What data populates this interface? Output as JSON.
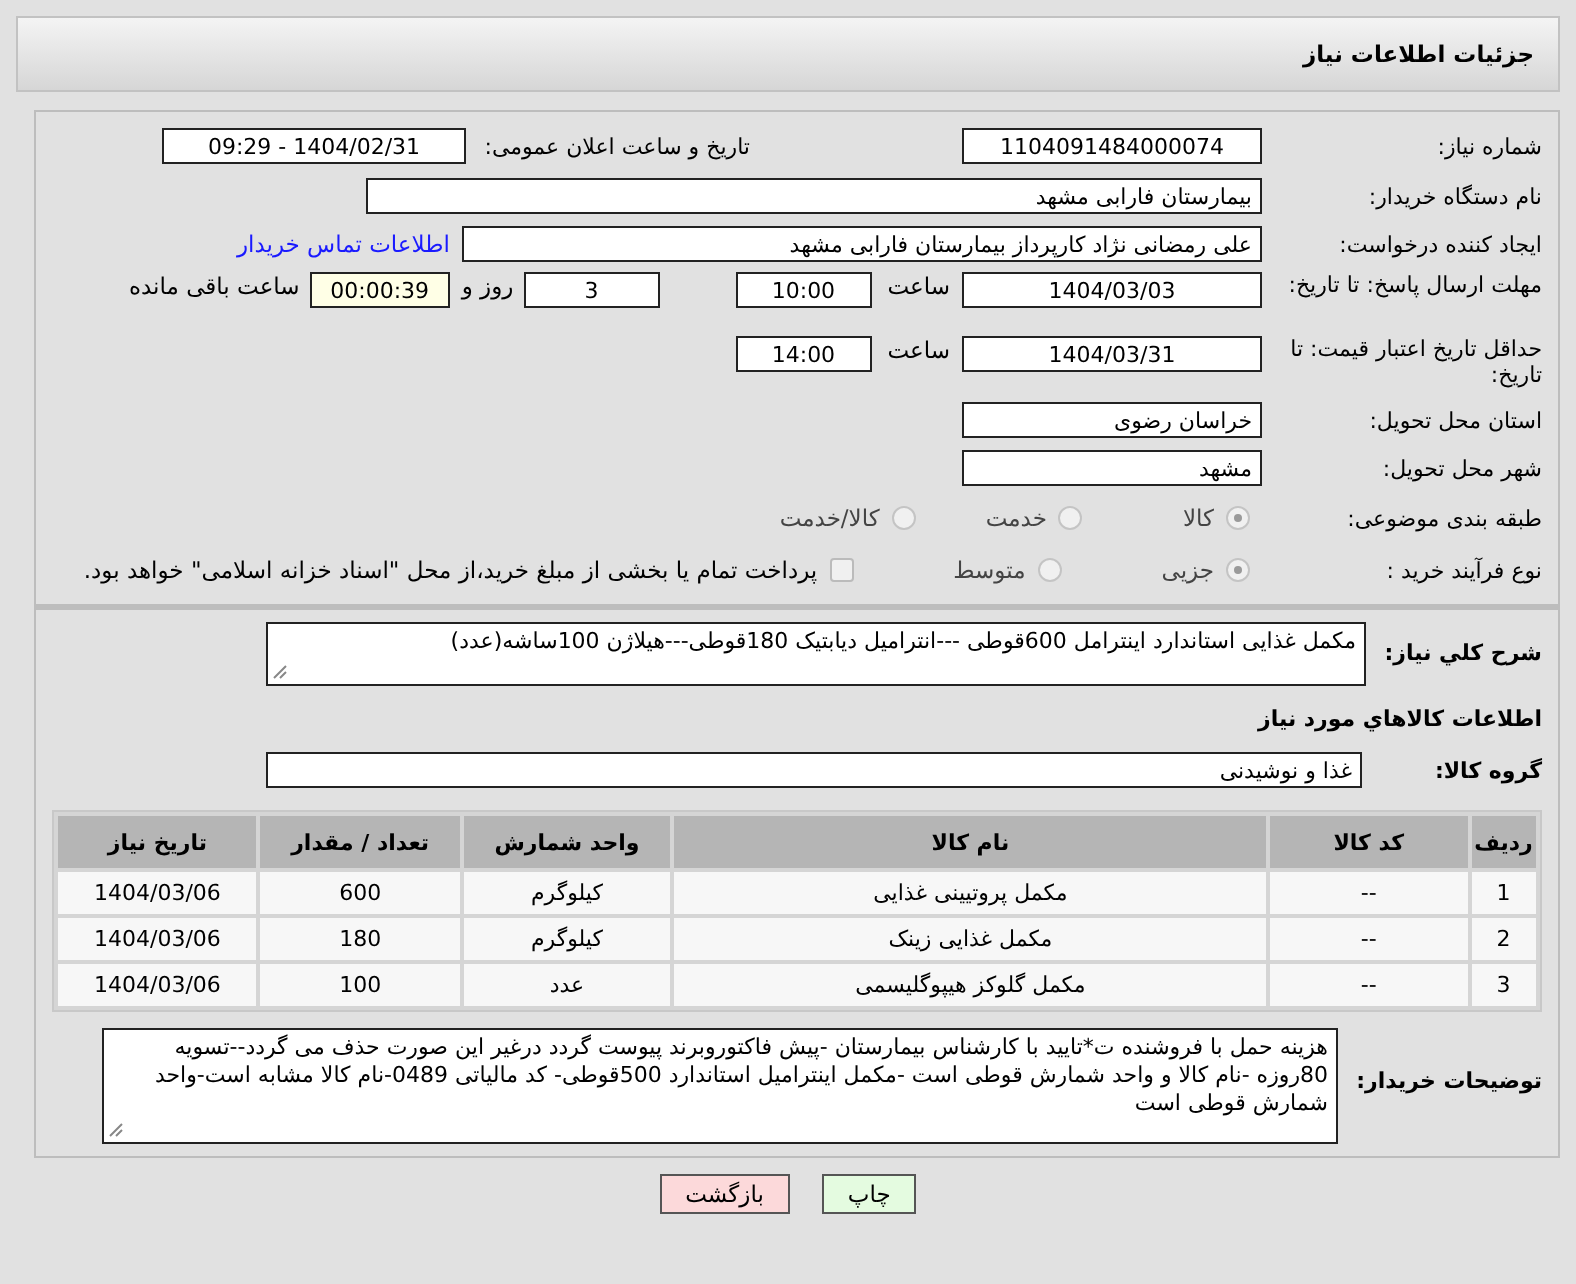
{
  "header": {
    "title": "جزئیات اطلاعات نیاز"
  },
  "need_number": {
    "label": "شماره نیاز:",
    "value": "1104091484000074"
  },
  "announce": {
    "label": "تاریخ و ساعت اعلان عمومی:",
    "value": "1404/02/31 - 09:29"
  },
  "buyer_org": {
    "label": "نام دستگاه خریدار:",
    "value": "بیمارستان فارابی مشهد"
  },
  "requester": {
    "label": "ایجاد کننده درخواست:",
    "value": "علی رمضانی نژاد کارپرداز بیمارستان فارابی مشهد",
    "link": "اطلاعات تماس خریدار"
  },
  "reply_deadline": {
    "label": "مهلت ارسال پاسخ: تا تاریخ:",
    "date": "1404/03/03",
    "time_label": "ساعت",
    "time": "10:00",
    "days": "3",
    "days_label": "روز و",
    "remaining": "00:00:39",
    "remaining_label": "ساعت باقی مانده"
  },
  "price_validity": {
    "label": "حداقل تاریخ اعتبار قیمت: تا تاریخ:",
    "date": "1404/03/31",
    "time_label": "ساعت",
    "time": "14:00"
  },
  "province": {
    "label": "استان محل تحویل:",
    "value": "خراسان رضوی"
  },
  "city": {
    "label": "شهر محل تحویل:",
    "value": "مشهد"
  },
  "category": {
    "label": "طبقه بندی موضوعی:",
    "options": [
      {
        "label": "کالا",
        "selected": true
      },
      {
        "label": "خدمت",
        "selected": false
      },
      {
        "label": "کالا/خدمت",
        "selected": false
      }
    ]
  },
  "purchase_process": {
    "label": "نوع فرآیند خرید :",
    "options": [
      {
        "label": "جزیی",
        "selected": true
      },
      {
        "label": "متوسط",
        "selected": false
      }
    ],
    "payment": {
      "label": "پرداخت تمام یا بخشی از مبلغ خرید،از محل \"اسناد خزانه اسلامی\" خواهد بود.",
      "checked": false
    }
  },
  "summary": {
    "label": "شرح کلي نياز:",
    "value": "مکمل غذایی استاندارد اینترامل 600قوطی ---انترامیل دیابتیک 180قوطی---هیلاژن 100ساشه(عدد)"
  },
  "goods_section": {
    "title": "اطلاعات كالاهاي مورد نياز"
  },
  "goods_group": {
    "label": "گروه کالا:",
    "value": "غذا و نوشیدنی"
  },
  "table": {
    "columns": [
      "ردیف",
      "کد کالا",
      "نام کالا",
      "واحد شمارش",
      "تعداد / مقدار",
      "تاریخ نیاز"
    ],
    "rows": [
      [
        "1",
        "--",
        "مکمل پروتیینی غذایی",
        "کیلوگرم",
        "600",
        "1404/03/06"
      ],
      [
        "2",
        "--",
        "مکمل غذایی زینک",
        "کیلوگرم",
        "180",
        "1404/03/06"
      ],
      [
        "3",
        "--",
        "مکمل گلوکز هیپوگلیسمی",
        "عدد",
        "100",
        "1404/03/06"
      ]
    ]
  },
  "buyer_notes": {
    "label": "توضیحات خریدار:",
    "value": "هزینه حمل با فروشنده ت*تایید با کارشناس بیمارستان -پیش فاکتوروبرند پیوست گردد درغیر این صورت حذف می گردد--تسویه 80روزه -نام کالا و واحد شمارش قوطی است -مکمل اینترامیل استاندارد 500قوطی- کد مالیاتی 0489-نام کالا مشابه است-واحد شمارش قوطی است"
  },
  "buttons": [
    {
      "label": "چاپ",
      "kind": "print"
    },
    {
      "label": "بازگشت",
      "kind": "back"
    }
  ]
}
